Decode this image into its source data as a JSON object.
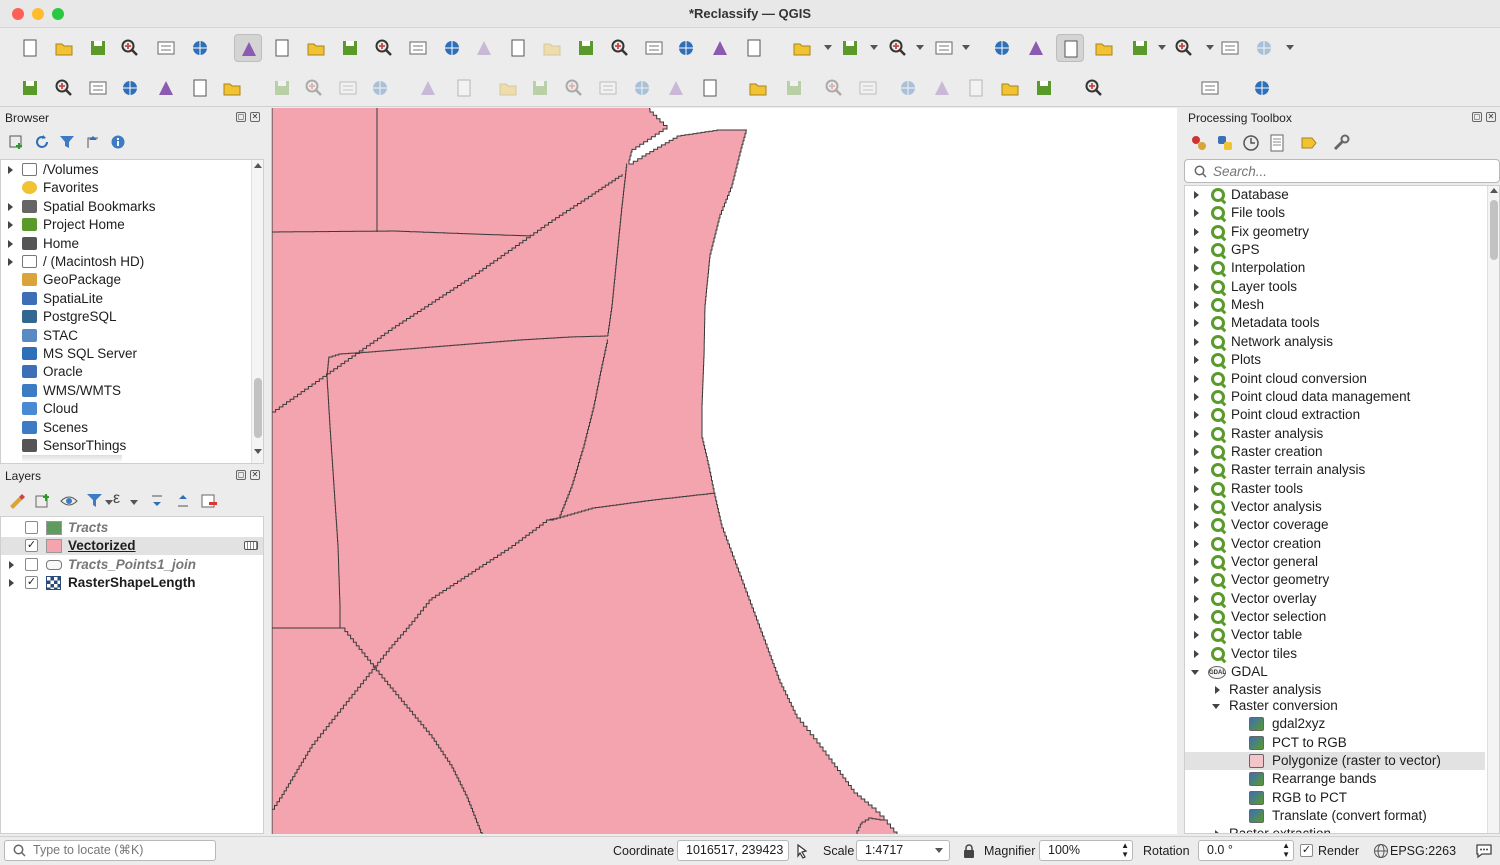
{
  "window": {
    "title": "*Reclassify — QGIS"
  },
  "toolbar_top": {
    "icons": [
      "new-project-icon",
      "open-project-icon",
      "save-project-icon",
      "print-layout-icon",
      "layout-manager-icon",
      "style-manager-icon",
      "pan-icon",
      "pan-to-selection-icon",
      "zoom-in-icon",
      "zoom-out-icon",
      "zoom-full-icon",
      "zoom-to-selection-icon",
      "zoom-to-layer-icon",
      "zoom-native-icon",
      "zoom-last-icon",
      "zoom-next-icon",
      "new-map-view-icon",
      "new-3d-view-icon",
      "new-bookmark-icon",
      "show-bookmarks-icon",
      "temporal-controller-icon",
      "refresh-icon",
      "select-features-icon",
      "select-by-expression-icon",
      "deselect-icon",
      "select-location-icon",
      "identify-icon",
      "attribute-table-icon",
      "processing-toolbox-icon",
      "statistics-icon",
      "open-field-calc-icon",
      "measure-icon",
      "map-tips-icon",
      "settings-icon"
    ]
  },
  "toolbar_second": {
    "icons": [
      "data-source-manager-icon",
      "new-geopackage-icon",
      "new-shapefile-icon",
      "digitize-icon",
      "new-spatialite-icon",
      "new-virtual-layer-icon",
      "new-temp-layer-icon",
      "edits-icon",
      "toggle-editing-icon",
      "save-edits-icon",
      "add-feature-icon",
      "vertex-tool-icon",
      "modify-attributes-icon",
      "delete-selected-icon",
      "cut-features-icon",
      "copy-features-icon",
      "paste-features-icon",
      "undo-icon",
      "redo-icon",
      "label-tool-icon",
      "diagram-tool-icon",
      "pin-labels-icon",
      "highlight-labels-icon",
      "show-hide-labels-icon",
      "move-label-icon",
      "rotate-label-icon",
      "change-label-icon",
      "plugin-globe-icon",
      "plugin-globe2-icon",
      "plugin-metasearch-icon",
      "python-console-icon",
      "help-icon"
    ]
  },
  "browser": {
    "title": "Browser",
    "items": [
      {
        "label": "/Volumes",
        "icon": "folder-icon",
        "expandable": true
      },
      {
        "label": "Favorites",
        "icon": "star-icon",
        "expandable": false
      },
      {
        "label": "Spatial Bookmarks",
        "icon": "bookmark-icon",
        "expandable": true
      },
      {
        "label": "Project Home",
        "icon": "project-home-icon",
        "expandable": true
      },
      {
        "label": "Home",
        "icon": "home-icon",
        "expandable": true
      },
      {
        "label": "/ (Macintosh HD)",
        "icon": "folder-icon",
        "expandable": true
      },
      {
        "label": "GeoPackage",
        "icon": "geopackage-icon",
        "expandable": false
      },
      {
        "label": "SpatiaLite",
        "icon": "spatialite-icon",
        "expandable": false
      },
      {
        "label": "PostgreSQL",
        "icon": "postgresql-icon",
        "expandable": false
      },
      {
        "label": "STAC",
        "icon": "stac-icon",
        "expandable": false
      },
      {
        "label": "MS SQL Server",
        "icon": "mssql-icon",
        "expandable": false
      },
      {
        "label": "Oracle",
        "icon": "oracle-icon",
        "expandable": false
      },
      {
        "label": "WMS/WMTS",
        "icon": "wms-icon",
        "expandable": false
      },
      {
        "label": "Cloud",
        "icon": "cloud-icon",
        "expandable": false
      },
      {
        "label": "Scenes",
        "icon": "scenes-icon",
        "expandable": false
      },
      {
        "label": "SensorThings",
        "icon": "sensorthings-icon",
        "expandable": false
      }
    ]
  },
  "layers": {
    "title": "Layers",
    "items": [
      {
        "name": "Tracts",
        "checked": false,
        "swatch": "#5f9a5f",
        "style": "italic",
        "expandable": false
      },
      {
        "name": "Vectorized",
        "checked": true,
        "swatch": "#f3a4ae",
        "style": "bold-underline",
        "expandable": false
      },
      {
        "name": "Tracts_Points1_join",
        "checked": false,
        "swatch": "none",
        "style": "italic",
        "expandable": true
      },
      {
        "name": "RasterShapeLength",
        "checked": true,
        "swatch": "raster",
        "style": "bold",
        "expandable": true
      }
    ]
  },
  "toolbox": {
    "title": "Processing Toolbox",
    "search_placeholder": "Search...",
    "groups": [
      "Database",
      "File tools",
      "Fix geometry",
      "GPS",
      "Interpolation",
      "Layer tools",
      "Mesh",
      "Metadata tools",
      "Network analysis",
      "Plots",
      "Point cloud conversion",
      "Point cloud data management",
      "Point cloud extraction",
      "Raster analysis",
      "Raster creation",
      "Raster terrain analysis",
      "Raster tools",
      "Vector analysis",
      "Vector coverage",
      "Vector creation",
      "Vector general",
      "Vector geometry",
      "Vector overlay",
      "Vector selection",
      "Vector table",
      "Vector tiles"
    ],
    "gdal": {
      "label": "GDAL",
      "subgroups": [
        "Raster analysis",
        "Raster conversion"
      ],
      "algorithms": [
        "gdal2xyz",
        "PCT to RGB",
        "Polygonize (raster to vector)",
        "Rearrange bands",
        "RGB to PCT",
        "Translate (convert format)"
      ],
      "selected": "Polygonize (raster to vector)",
      "next_subgroup": "Raster extraction"
    }
  },
  "map": {
    "polygon_fill": "#f3a4ae",
    "edge_color": "#3a3a3a",
    "background": "#ffffff"
  },
  "status": {
    "locator_placeholder": "Type to locate (⌘K)",
    "coordinate_label": "Coordinate",
    "coordinate_value": "1016517, 239423",
    "scale_label": "Scale",
    "scale_value": "1:4717",
    "magnifier_label": "Magnifier",
    "magnifier_value": "100%",
    "rotation_label": "Rotation",
    "rotation_value": "0.0 °",
    "render_label": "Render",
    "render_checked": true,
    "crs": "EPSG:2263"
  }
}
